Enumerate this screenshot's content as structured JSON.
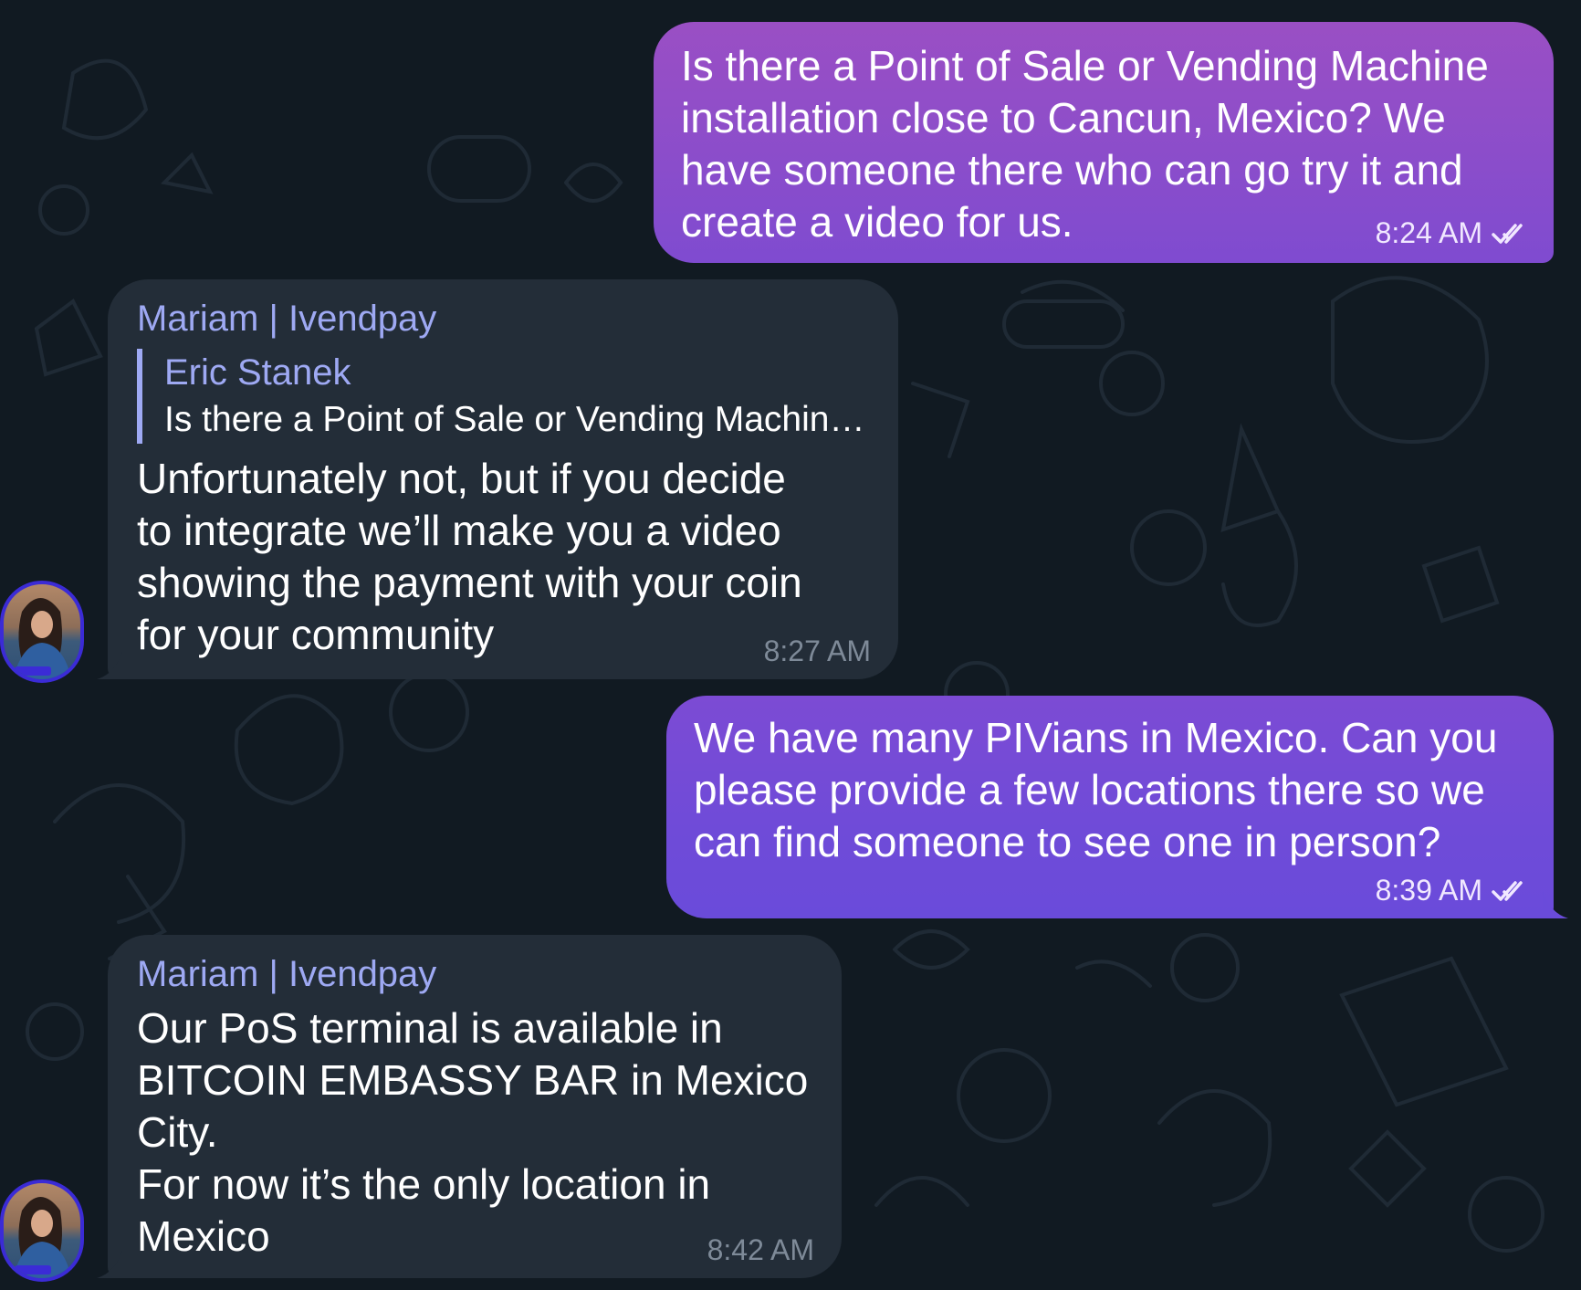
{
  "chat": {
    "messages": [
      {
        "direction": "out",
        "text": "Is there a Point of Sale or Vending Machine\ninstallation close to Cancun, Mexico? We\nhave someone there who can go try it and\ncreate a video for us.",
        "time": "8:24 AM",
        "status_icon": "double-check-icon"
      },
      {
        "direction": "in",
        "sender": "Mariam | Ivendpay",
        "reply_to": {
          "name": "Eric Stanek",
          "text": "Is there a Point of Sale or Vending Machin…"
        },
        "text": "Unfortunately not, but if you decide\nto integrate we’ll make you a video\nshowing the payment with your coin\nfor your community",
        "time": "8:27 AM",
        "avatar_badge": "ivendpay"
      },
      {
        "direction": "out",
        "text": "We have many PIVians in Mexico. Can you\nplease provide a few locations there so we\ncan find someone to see one in person?",
        "time": "8:39 AM",
        "status_icon": "double-check-icon"
      },
      {
        "direction": "in",
        "sender": "Mariam | Ivendpay",
        "text": "Our PoS terminal is available in\nBITCOIN EMBASSY BAR in Mexico\nCity.\nFor now it’s the only location in\nMexico",
        "time": "8:42 AM",
        "avatar_badge": "ivendpay"
      }
    ]
  },
  "colors": {
    "background": "#111a22",
    "incoming_bubble": "#232d38",
    "outgoing_gradient_top": "#9a4fc4",
    "outgoing_gradient_bottom": "#6c4bd8",
    "sender_name": "#9ea9f3"
  }
}
